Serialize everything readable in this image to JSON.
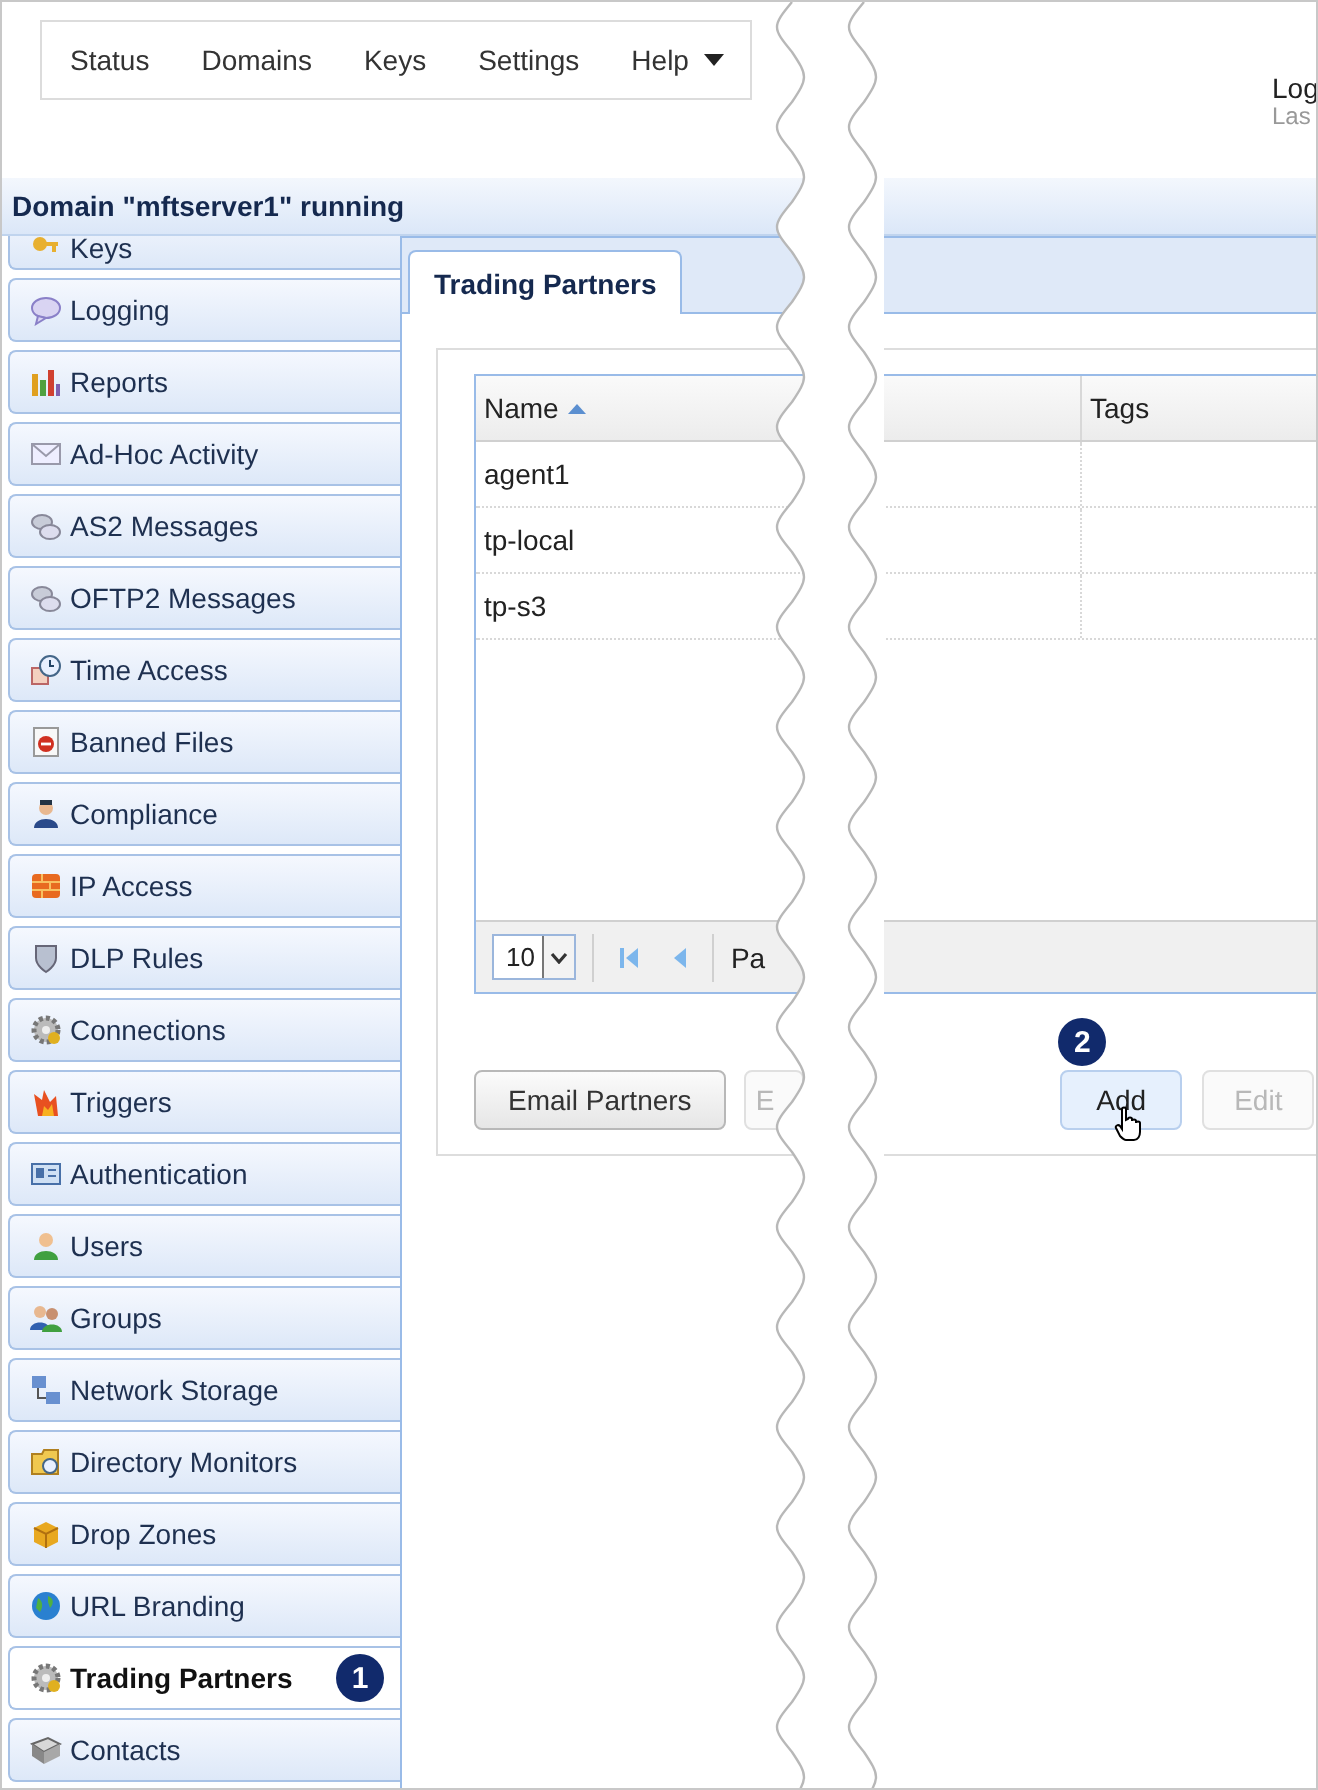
{
  "nav": {
    "items": [
      {
        "label": "Status",
        "dropdown": false
      },
      {
        "label": "Domains",
        "dropdown": false
      },
      {
        "label": "Keys",
        "dropdown": false
      },
      {
        "label": "Settings",
        "dropdown": false
      },
      {
        "label": "Help",
        "dropdown": true
      }
    ]
  },
  "user": {
    "line_1": "Log",
    "line_2": "Las"
  },
  "domain_title": "Domain \"mftserver1\" running",
  "sidebar": {
    "items": [
      {
        "label": "Keys",
        "selected": false
      },
      {
        "label": "Logging",
        "selected": false
      },
      {
        "label": "Reports",
        "selected": false
      },
      {
        "label": "Ad-Hoc Activity",
        "selected": false
      },
      {
        "label": "AS2 Messages",
        "selected": false
      },
      {
        "label": "OFTP2 Messages",
        "selected": false
      },
      {
        "label": "Time Access",
        "selected": false
      },
      {
        "label": "Banned Files",
        "selected": false
      },
      {
        "label": "Compliance",
        "selected": false
      },
      {
        "label": "IP Access",
        "selected": false
      },
      {
        "label": "DLP Rules",
        "selected": false
      },
      {
        "label": "Connections",
        "selected": false
      },
      {
        "label": "Triggers",
        "selected": false
      },
      {
        "label": "Authentication",
        "selected": false
      },
      {
        "label": "Users",
        "selected": false
      },
      {
        "label": "Groups",
        "selected": false
      },
      {
        "label": "Network Storage",
        "selected": false
      },
      {
        "label": "Directory Monitors",
        "selected": false
      },
      {
        "label": "Drop Zones",
        "selected": false
      },
      {
        "label": "URL Branding",
        "selected": false
      },
      {
        "label": "Trading Partners",
        "selected": true,
        "callout": "1"
      },
      {
        "label": "Contacts",
        "selected": false
      }
    ]
  },
  "tabs": [
    {
      "label": "Trading Partners",
      "selected": true
    }
  ],
  "table": {
    "columns": [
      {
        "label": "Name",
        "sorted": true
      },
      {
        "label": "Tags",
        "sorted": false
      }
    ],
    "rows": [
      {
        "name": "agent1"
      },
      {
        "name": "tp-local"
      },
      {
        "name": "tp-s3"
      }
    ],
    "pager": {
      "page_size": "10",
      "page_label": "Pa"
    }
  },
  "buttons": [
    {
      "label": "Email Partners",
      "disabled": false,
      "hovered": false
    },
    {
      "label": "E",
      "disabled": true,
      "hovered": false
    },
    {
      "label": "Add",
      "disabled": false,
      "hovered": true,
      "callout": "2"
    },
    {
      "label": "Edit",
      "disabled": true,
      "hovered": false
    }
  ]
}
